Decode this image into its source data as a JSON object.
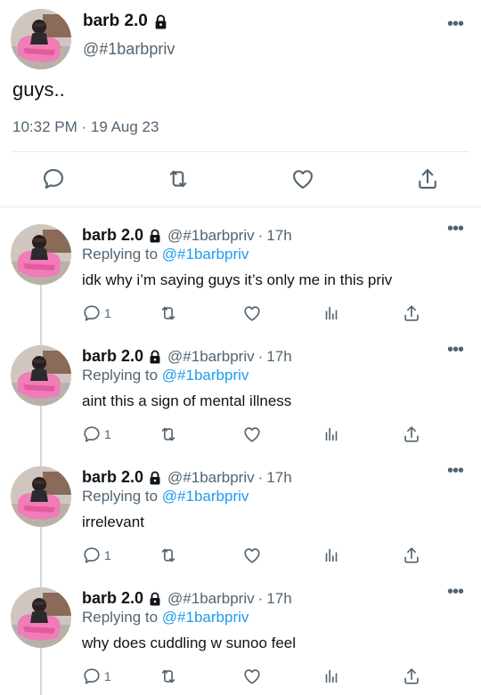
{
  "main_tweet": {
    "display_name": "barb 2.0",
    "handle": "@#1barbpriv",
    "text": "guys..",
    "timestamp": "10:32 PM · 19 Aug 23",
    "icons": [
      "lock-icon",
      "more-icon",
      "reply-icon",
      "retweet-icon",
      "like-icon",
      "share-icon"
    ]
  },
  "replies": [
    {
      "display_name": "barb 2.0",
      "handle": "@#1barbpriv",
      "separator": "·",
      "time": "17h",
      "replying_prefix": "Replying to",
      "replying_to": "@#1barbpriv",
      "text": "idk why i’m saying guys it’s only me in this priv",
      "reply_count": "1"
    },
    {
      "display_name": "barb 2.0",
      "handle": "@#1barbpriv",
      "separator": "·",
      "time": "17h",
      "replying_prefix": "Replying to",
      "replying_to": "@#1barbpriv",
      "text": "aint this a sign of mental illness",
      "reply_count": "1"
    },
    {
      "display_name": "barb 2.0",
      "handle": "@#1barbpriv",
      "separator": "·",
      "time": "17h",
      "replying_prefix": "Replying to",
      "replying_to": "@#1barbpriv",
      "text": "irrelevant",
      "reply_count": "1"
    },
    {
      "display_name": "barb 2.0",
      "handle": "@#1barbpriv",
      "separator": "·",
      "time": "17h",
      "replying_prefix": "Replying to",
      "replying_to": "@#1barbpriv",
      "text": "why does cuddling w sunoo feel",
      "reply_count": "1"
    }
  ],
  "colors": {
    "text": "#0f1419",
    "secondary": "#536471",
    "link": "#1d9bf0",
    "divider": "#e6e9eb",
    "thread_line": "#cfd9de"
  }
}
